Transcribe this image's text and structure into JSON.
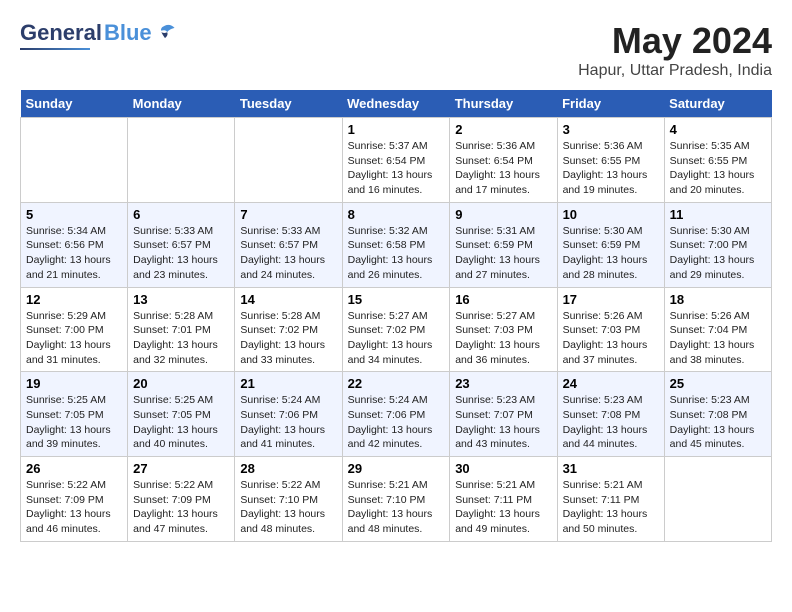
{
  "header": {
    "logo_general": "General",
    "logo_blue": "Blue",
    "title": "May 2024",
    "subtitle": "Hapur, Uttar Pradesh, India"
  },
  "days_of_week": [
    "Sunday",
    "Monday",
    "Tuesday",
    "Wednesday",
    "Thursday",
    "Friday",
    "Saturday"
  ],
  "weeks": [
    [
      {
        "day": "",
        "info": ""
      },
      {
        "day": "",
        "info": ""
      },
      {
        "day": "",
        "info": ""
      },
      {
        "day": "1",
        "info": "Sunrise: 5:37 AM\nSunset: 6:54 PM\nDaylight: 13 hours and 16 minutes."
      },
      {
        "day": "2",
        "info": "Sunrise: 5:36 AM\nSunset: 6:54 PM\nDaylight: 13 hours and 17 minutes."
      },
      {
        "day": "3",
        "info": "Sunrise: 5:36 AM\nSunset: 6:55 PM\nDaylight: 13 hours and 19 minutes."
      },
      {
        "day": "4",
        "info": "Sunrise: 5:35 AM\nSunset: 6:55 PM\nDaylight: 13 hours and 20 minutes."
      }
    ],
    [
      {
        "day": "5",
        "info": "Sunrise: 5:34 AM\nSunset: 6:56 PM\nDaylight: 13 hours and 21 minutes."
      },
      {
        "day": "6",
        "info": "Sunrise: 5:33 AM\nSunset: 6:57 PM\nDaylight: 13 hours and 23 minutes."
      },
      {
        "day": "7",
        "info": "Sunrise: 5:33 AM\nSunset: 6:57 PM\nDaylight: 13 hours and 24 minutes."
      },
      {
        "day": "8",
        "info": "Sunrise: 5:32 AM\nSunset: 6:58 PM\nDaylight: 13 hours and 26 minutes."
      },
      {
        "day": "9",
        "info": "Sunrise: 5:31 AM\nSunset: 6:59 PM\nDaylight: 13 hours and 27 minutes."
      },
      {
        "day": "10",
        "info": "Sunrise: 5:30 AM\nSunset: 6:59 PM\nDaylight: 13 hours and 28 minutes."
      },
      {
        "day": "11",
        "info": "Sunrise: 5:30 AM\nSunset: 7:00 PM\nDaylight: 13 hours and 29 minutes."
      }
    ],
    [
      {
        "day": "12",
        "info": "Sunrise: 5:29 AM\nSunset: 7:00 PM\nDaylight: 13 hours and 31 minutes."
      },
      {
        "day": "13",
        "info": "Sunrise: 5:28 AM\nSunset: 7:01 PM\nDaylight: 13 hours and 32 minutes."
      },
      {
        "day": "14",
        "info": "Sunrise: 5:28 AM\nSunset: 7:02 PM\nDaylight: 13 hours and 33 minutes."
      },
      {
        "day": "15",
        "info": "Sunrise: 5:27 AM\nSunset: 7:02 PM\nDaylight: 13 hours and 34 minutes."
      },
      {
        "day": "16",
        "info": "Sunrise: 5:27 AM\nSunset: 7:03 PM\nDaylight: 13 hours and 36 minutes."
      },
      {
        "day": "17",
        "info": "Sunrise: 5:26 AM\nSunset: 7:03 PM\nDaylight: 13 hours and 37 minutes."
      },
      {
        "day": "18",
        "info": "Sunrise: 5:26 AM\nSunset: 7:04 PM\nDaylight: 13 hours and 38 minutes."
      }
    ],
    [
      {
        "day": "19",
        "info": "Sunrise: 5:25 AM\nSunset: 7:05 PM\nDaylight: 13 hours and 39 minutes."
      },
      {
        "day": "20",
        "info": "Sunrise: 5:25 AM\nSunset: 7:05 PM\nDaylight: 13 hours and 40 minutes."
      },
      {
        "day": "21",
        "info": "Sunrise: 5:24 AM\nSunset: 7:06 PM\nDaylight: 13 hours and 41 minutes."
      },
      {
        "day": "22",
        "info": "Sunrise: 5:24 AM\nSunset: 7:06 PM\nDaylight: 13 hours and 42 minutes."
      },
      {
        "day": "23",
        "info": "Sunrise: 5:23 AM\nSunset: 7:07 PM\nDaylight: 13 hours and 43 minutes."
      },
      {
        "day": "24",
        "info": "Sunrise: 5:23 AM\nSunset: 7:08 PM\nDaylight: 13 hours and 44 minutes."
      },
      {
        "day": "25",
        "info": "Sunrise: 5:23 AM\nSunset: 7:08 PM\nDaylight: 13 hours and 45 minutes."
      }
    ],
    [
      {
        "day": "26",
        "info": "Sunrise: 5:22 AM\nSunset: 7:09 PM\nDaylight: 13 hours and 46 minutes."
      },
      {
        "day": "27",
        "info": "Sunrise: 5:22 AM\nSunset: 7:09 PM\nDaylight: 13 hours and 47 minutes."
      },
      {
        "day": "28",
        "info": "Sunrise: 5:22 AM\nSunset: 7:10 PM\nDaylight: 13 hours and 48 minutes."
      },
      {
        "day": "29",
        "info": "Sunrise: 5:21 AM\nSunset: 7:10 PM\nDaylight: 13 hours and 48 minutes."
      },
      {
        "day": "30",
        "info": "Sunrise: 5:21 AM\nSunset: 7:11 PM\nDaylight: 13 hours and 49 minutes."
      },
      {
        "day": "31",
        "info": "Sunrise: 5:21 AM\nSunset: 7:11 PM\nDaylight: 13 hours and 50 minutes."
      },
      {
        "day": "",
        "info": ""
      }
    ]
  ]
}
